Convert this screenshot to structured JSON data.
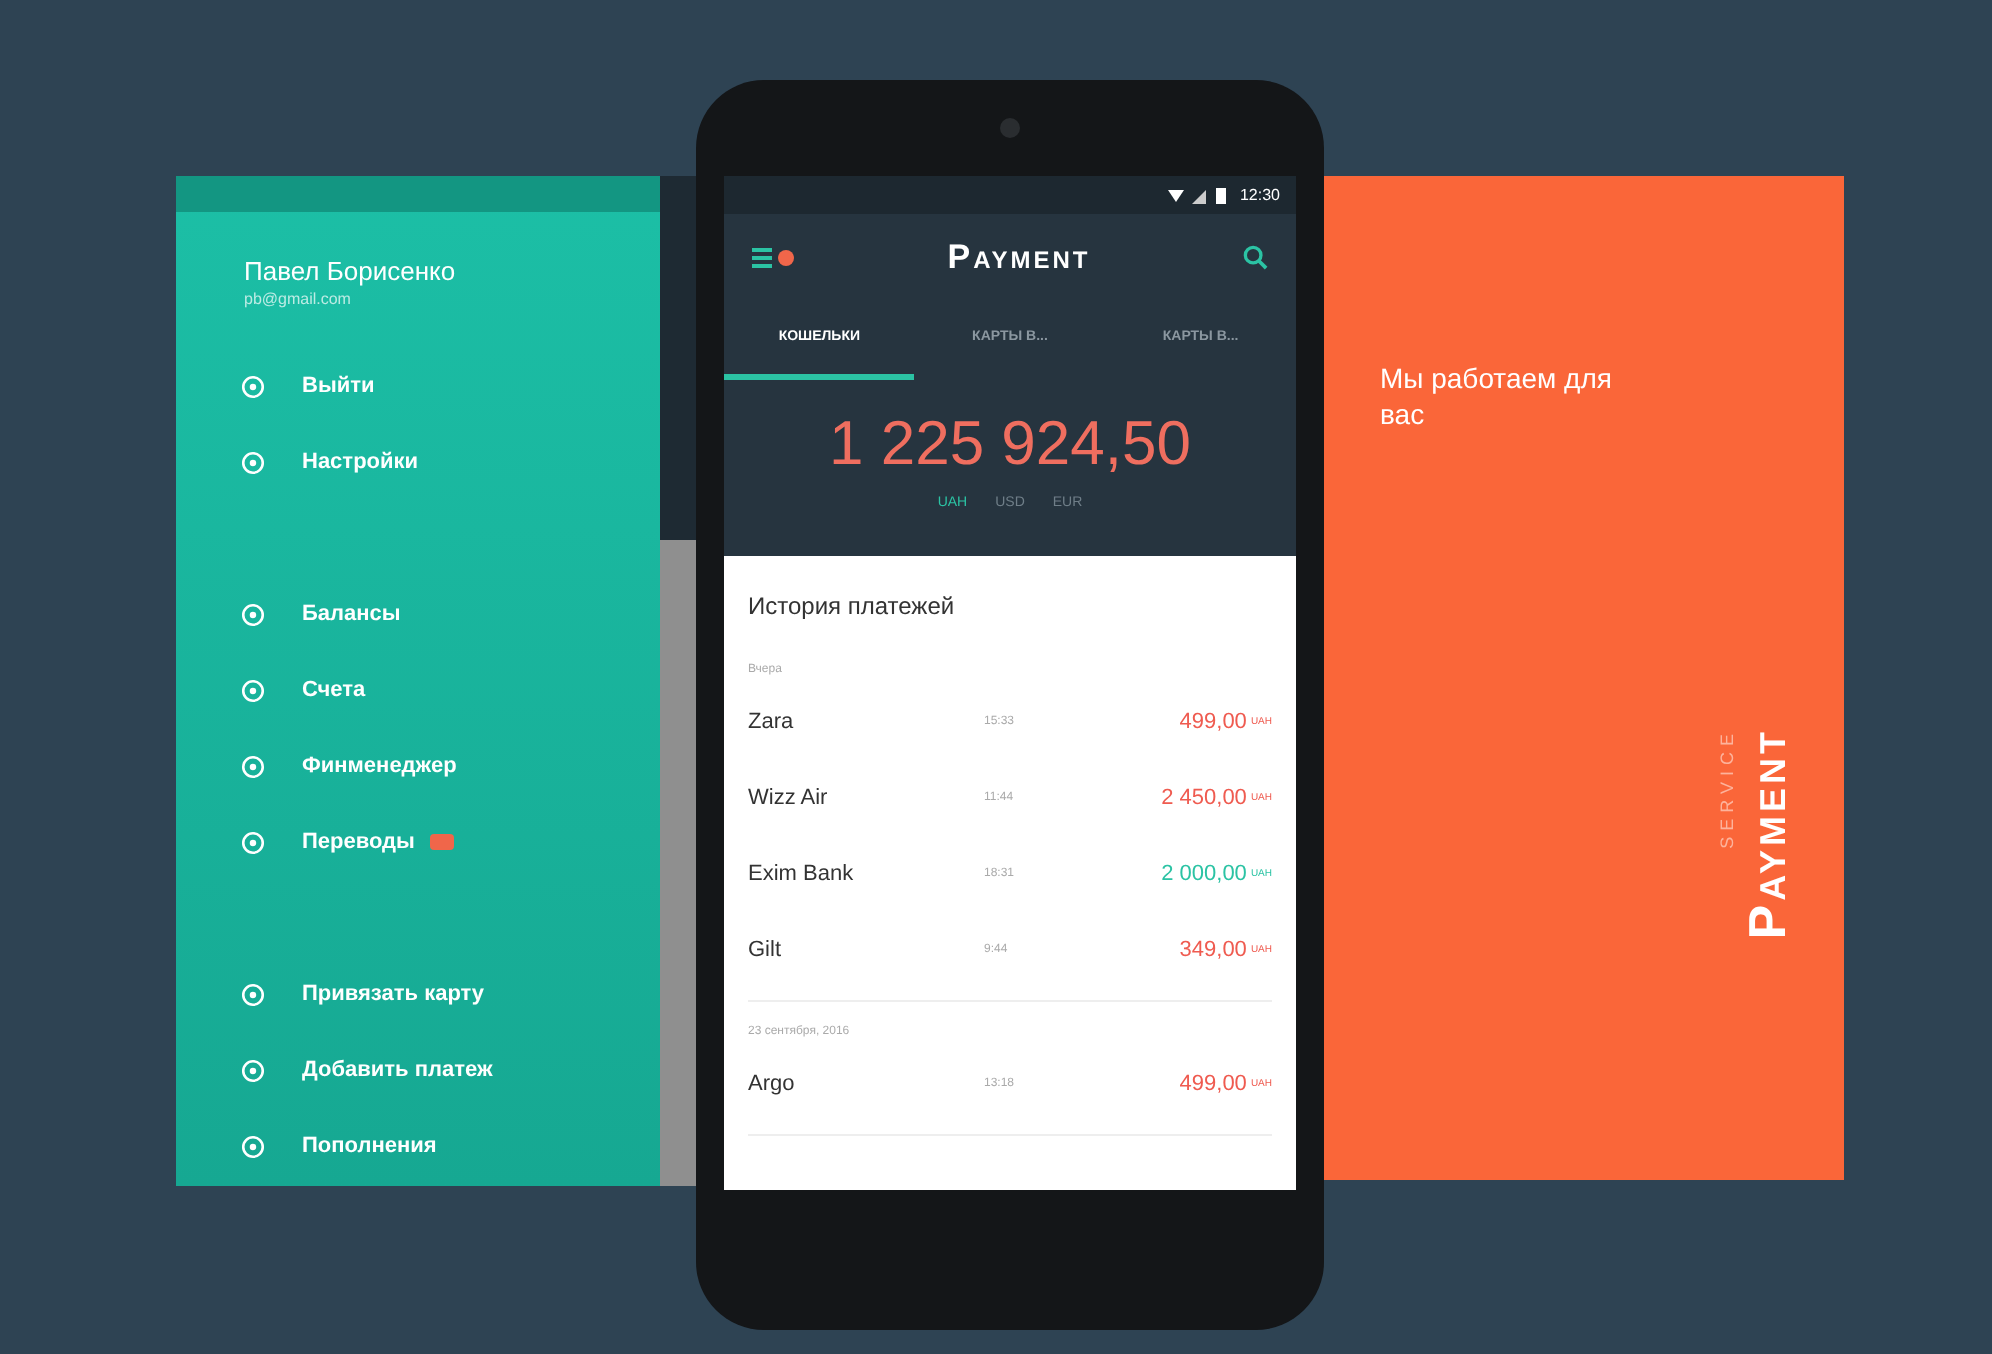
{
  "drawer": {
    "user_name": "Павел Борисенко",
    "user_email": "pb@gmail.com",
    "groups": [
      [
        {
          "label": "Выйти",
          "badge": false
        },
        {
          "label": "Настройки",
          "badge": false
        }
      ],
      [
        {
          "label": "Балансы",
          "badge": false
        },
        {
          "label": "Счета",
          "badge": false
        },
        {
          "label": "Финменеджер",
          "badge": false
        },
        {
          "label": "Переводы",
          "badge": true
        }
      ],
      [
        {
          "label": "Привязать карту",
          "badge": false
        },
        {
          "label": "Добавить платеж",
          "badge": false
        },
        {
          "label": "Пополнения",
          "badge": false
        }
      ]
    ]
  },
  "phone": {
    "status_time": "12:30",
    "app_title": "Payment",
    "tabs": [
      {
        "label": "КОШЕЛЬКИ",
        "selected": true
      },
      {
        "label": "КАРТЫ В...",
        "selected": false
      },
      {
        "label": "КАРТЫ В...",
        "selected": false
      }
    ],
    "balance": "1 225 924,50",
    "currencies": [
      {
        "label": "UAH",
        "selected": true
      },
      {
        "label": "USD",
        "selected": false
      },
      {
        "label": "EUR",
        "selected": false
      }
    ],
    "history_title": "История платежей",
    "groups": [
      {
        "date": "Вчера",
        "payments": [
          {
            "name": "Zara",
            "time": "15:33",
            "amount": "499,00",
            "currency": "UAH",
            "kind": "debit"
          },
          {
            "name": "Wizz Air",
            "time": "11:44",
            "amount": "2 450,00",
            "currency": "UAH",
            "kind": "debit"
          },
          {
            "name": "Exim Bank",
            "time": "18:31",
            "amount": "2 000,00",
            "currency": "UAH",
            "kind": "credit"
          },
          {
            "name": "Gilt",
            "time": "9:44",
            "amount": "349,00",
            "currency": "UAH",
            "kind": "debit"
          }
        ]
      },
      {
        "date": "23 сентября, 2016",
        "payments": [
          {
            "name": "Argo",
            "time": "13:18",
            "amount": "499,00",
            "currency": "UAH",
            "kind": "debit"
          }
        ]
      }
    ]
  },
  "promo": {
    "tagline": "Мы работаем для вас",
    "brand": "Payment",
    "brand_sub": "SERVICE"
  }
}
